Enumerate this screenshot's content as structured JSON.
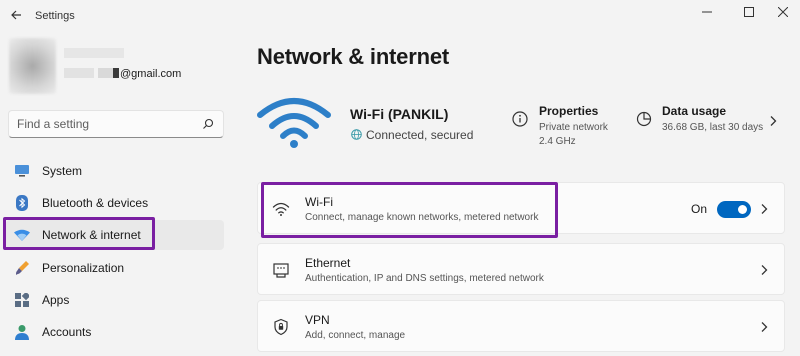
{
  "window": {
    "title": "Settings",
    "controls": {
      "minimize": "—",
      "maximize": "☐",
      "close": "✕"
    }
  },
  "profile": {
    "email_suffix": "@gmail.com"
  },
  "search": {
    "placeholder": "Find a setting"
  },
  "sidebar": {
    "items": [
      {
        "label": "System",
        "icon": "monitor-icon"
      },
      {
        "label": "Bluetooth & devices",
        "icon": "bluetooth-icon"
      },
      {
        "label": "Network & internet",
        "icon": "wifi-icon",
        "active": true
      },
      {
        "label": "Personalization",
        "icon": "brush-icon"
      },
      {
        "label": "Apps",
        "icon": "apps-icon"
      },
      {
        "label": "Accounts",
        "icon": "person-icon"
      }
    ]
  },
  "main": {
    "page_title": "Network & internet",
    "connection": {
      "name": "Wi-Fi (PANKIL)",
      "status": "Connected, secured"
    },
    "properties": {
      "title": "Properties",
      "line1": "Private network",
      "line2": "2.4 GHz"
    },
    "data_usage": {
      "title": "Data usage",
      "summary": "36.68 GB, last 30 days"
    },
    "cards": [
      {
        "title": "Wi-Fi",
        "subtitle": "Connect, manage known networks, metered network",
        "icon": "wifi-icon",
        "toggle_label": "On",
        "toggle_on": true
      },
      {
        "title": "Ethernet",
        "subtitle": "Authentication, IP and DNS settings, metered network",
        "icon": "ethernet-icon"
      },
      {
        "title": "VPN",
        "subtitle": "Add, connect, manage",
        "icon": "shield-icon"
      }
    ]
  },
  "colors": {
    "accent": "#0067c0",
    "highlight": "#7a1fa2",
    "background": "#f3f3f3"
  }
}
